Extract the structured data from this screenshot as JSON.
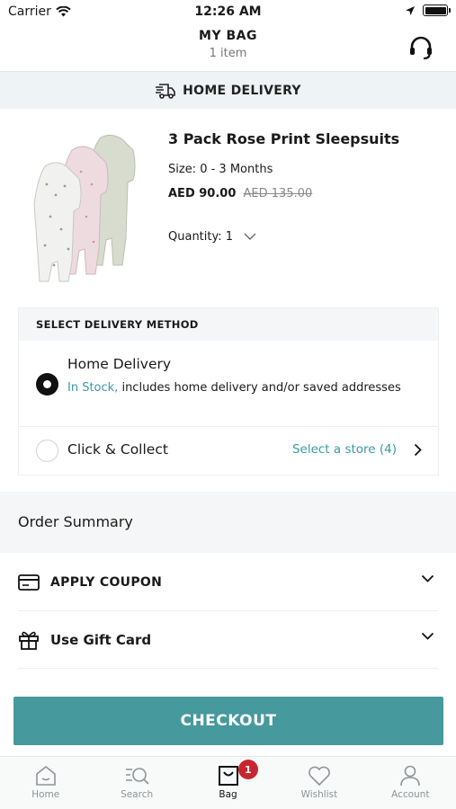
{
  "status_bar": {
    "carrier": "Carrier",
    "time": "12:26 AM"
  },
  "header": {
    "title": "MY BAG",
    "subtitle": "1 item",
    "support_icon": "headset-icon"
  },
  "banner": {
    "label": "HOME DELIVERY",
    "icon": "delivery-truck-icon"
  },
  "product": {
    "name": "3 Pack Rose Print Sleepsuits",
    "size": "Size: 0 - 3 Months",
    "price": "AED 90.00",
    "was_price": "AED 135.00",
    "quantity": "Quantity: 1"
  },
  "delivery_method": {
    "heading": "SELECT DELIVERY METHOD",
    "home": {
      "title": "Home Delivery",
      "stock": "In Stock,",
      "desc": " includes home delivery and/or saved addresses",
      "selected": true
    },
    "collect": {
      "title": "Click & Collect",
      "store": "Select a store (4)",
      "selected": false
    }
  },
  "order_summary": {
    "heading": "Order Summary",
    "coupon": "APPLY COUPON",
    "gift": "Use Gift Card"
  },
  "checkout": "CHECKOUT",
  "tabs": [
    {
      "label": "Home",
      "icon": "home-icon"
    },
    {
      "label": "Search",
      "icon": "search-icon"
    },
    {
      "label": "Bag",
      "icon": "bag-icon",
      "badge": "1",
      "active": true
    },
    {
      "label": "Wishlist",
      "icon": "heart-icon"
    },
    {
      "label": "Account",
      "icon": "account-icon"
    }
  ],
  "colors": {
    "accent": "#46999c",
    "teal_text": "#3a9aa0",
    "badge": "#c8262f"
  }
}
